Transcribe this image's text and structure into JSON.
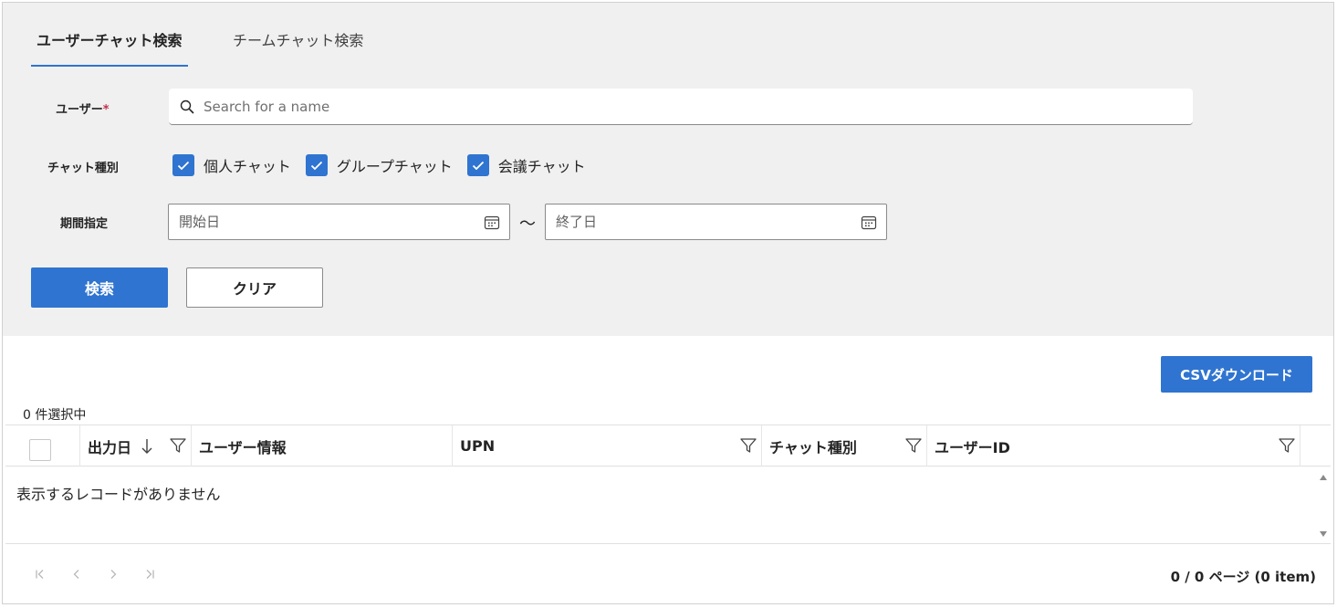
{
  "tabs": [
    {
      "label": "ユーザーチャット検索",
      "active": true
    },
    {
      "label": "チームチャット検索",
      "active": false
    }
  ],
  "form": {
    "user_label": "ユーザー",
    "required_mark": "*",
    "search_placeholder": "Search for a name",
    "chat_type_label": "チャット種別",
    "chat_types": [
      {
        "label": "個人チャット",
        "checked": true
      },
      {
        "label": "グループチャット",
        "checked": true
      },
      {
        "label": "会議チャット",
        "checked": true
      }
    ],
    "period_label": "期間指定",
    "start_placeholder": "開始日",
    "range_separator": "～",
    "end_placeholder": "終了日",
    "search_button": "検索",
    "clear_button": "クリア"
  },
  "results": {
    "csv_button": "CSVダウンロード",
    "selected_count": "0 件選択中",
    "columns": [
      {
        "label": "出力日",
        "sorted": "descending"
      },
      {
        "label": "ユーザー情報"
      },
      {
        "label": "UPN"
      },
      {
        "label": "チャット種別"
      },
      {
        "label": "ユーザーID"
      }
    ],
    "empty_message": "表示するレコードがありません",
    "pager": {
      "first": "|<",
      "prev": "<",
      "next": ">",
      "last": ">|",
      "info": "0 / 0 ページ (0 item)"
    }
  },
  "colors": {
    "accent": "#2f74d0",
    "panel_bg": "#f0f0f0",
    "required": "#c4314b"
  }
}
